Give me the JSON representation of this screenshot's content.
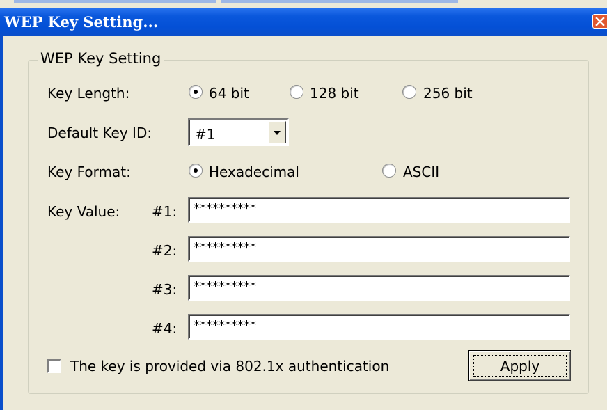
{
  "window": {
    "title": "WEP Key Setting..."
  },
  "group": {
    "label": "WEP Key Setting"
  },
  "key_length": {
    "label": "Key Length:",
    "options": [
      "64 bit",
      "128 bit",
      "256 bit"
    ],
    "selected": "64 bit"
  },
  "default_key_id": {
    "label": "Default Key ID:",
    "value": "#1"
  },
  "key_format": {
    "label": "Key Format:",
    "options": [
      "Hexadecimal",
      "ASCII"
    ],
    "selected": "Hexadecimal"
  },
  "key_value": {
    "label": "Key Value:",
    "keys": [
      {
        "id": "#1:",
        "value": "**********"
      },
      {
        "id": "#2:",
        "value": "**********"
      },
      {
        "id": "#3:",
        "value": "**********"
      },
      {
        "id": "#4:",
        "value": "**********"
      }
    ]
  },
  "auth_checkbox": {
    "label": "The key is provided via 802.1x authentication",
    "checked": false
  },
  "apply_button": {
    "label": "Apply"
  },
  "colors": {
    "titlebar": "#0A58DC",
    "window_bg": "#ECE9D8",
    "close_button": "#E0572E"
  }
}
